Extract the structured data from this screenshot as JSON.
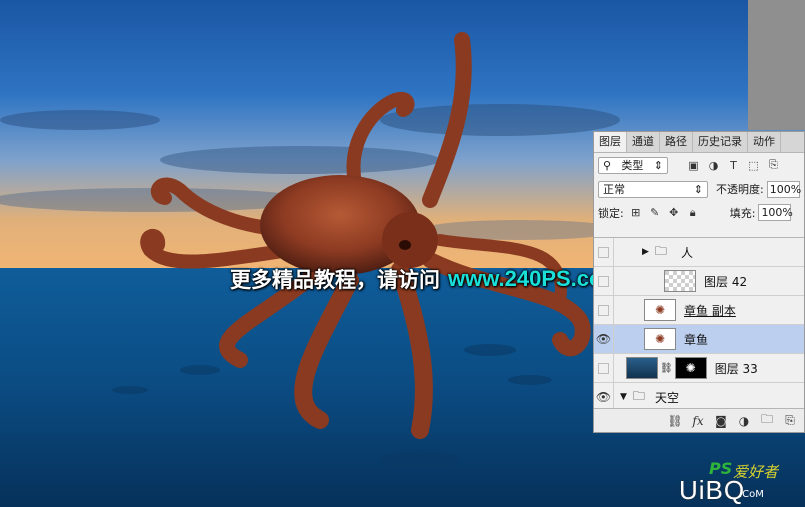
{
  "banner": {
    "text": "更多精品教程，请访问",
    "url": "www.240PS.com"
  },
  "panel": {
    "tabs": [
      "图层",
      "通道",
      "路径",
      "历史记录",
      "动作"
    ],
    "filter_kind": "类型",
    "blend_mode": "正常",
    "opacity_label": "不透明度:",
    "opacity_value": "100%",
    "lock_label": "锁定:",
    "fill_label": "填充:",
    "fill_value": "100%",
    "layers": [
      {
        "name": "人",
        "type": "group",
        "visible": false,
        "expanded": false
      },
      {
        "name": "图层 42",
        "type": "layer",
        "visible": false
      },
      {
        "name": "章鱼 副本",
        "type": "layer",
        "visible": false
      },
      {
        "name": "章鱼",
        "type": "layer",
        "visible": true,
        "selected": true
      },
      {
        "name": "图层 33",
        "type": "masked",
        "visible": false
      },
      {
        "name": "天空",
        "type": "group",
        "visible": true,
        "expanded": true
      }
    ]
  },
  "watermark": {
    "ps": "PS",
    "site": "爱好者",
    "brand": "UiBQ",
    "suffix": ".CoM"
  },
  "colors": {
    "sky_top": "#1a5fb0",
    "horizon": "#f0b070",
    "sea": "#0b4f85",
    "selected_row": "#bccfef",
    "url": "#19e0d8"
  }
}
